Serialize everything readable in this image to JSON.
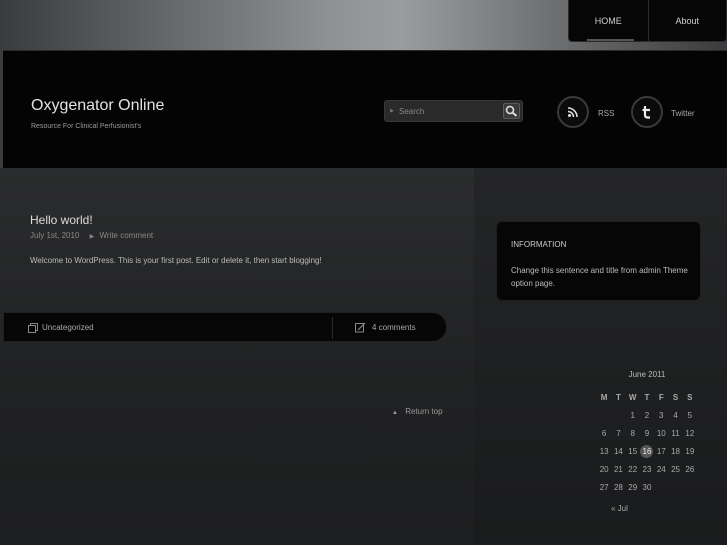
{
  "nav": {
    "home": "HOME",
    "about": "About"
  },
  "site": {
    "title": "Oxygenator Online",
    "tagline": "Resource For Clinical Perfusionist's"
  },
  "search": {
    "placeholder": "Search"
  },
  "social": {
    "rss": "RSS",
    "twitter": "Twitter"
  },
  "post": {
    "title": "Hello world!",
    "date": "July 1st, 2010",
    "write_comment": "Write comment",
    "body": "Welcome to WordPress. This is your first post. Edit or delete it, then start blogging!",
    "category": "Uncategorized",
    "comments": "4 comments"
  },
  "return_top": "Return top",
  "info": {
    "title": "INFORMATION",
    "text": "Change this sentence and title from admin Theme option page."
  },
  "calendar": {
    "caption": "June 2011",
    "days": [
      "M",
      "T",
      "W",
      "T",
      "F",
      "S",
      "S"
    ],
    "weeks": [
      [
        "",
        "",
        "1",
        "2",
        "3",
        "4",
        "5"
      ],
      [
        "6",
        "7",
        "8",
        "9",
        "10",
        "11",
        "12"
      ],
      [
        "13",
        "14",
        "15",
        "16",
        "17",
        "18",
        "19"
      ],
      [
        "20",
        "21",
        "22",
        "23",
        "24",
        "25",
        "26"
      ],
      [
        "27",
        "28",
        "29",
        "30",
        "",
        "",
        ""
      ]
    ],
    "today": "16",
    "prev": "« Jul"
  },
  "colors": {
    "header_bg": "#040404",
    "footer_bar": "#060606",
    "today_highlight": "#555555"
  },
  "icons": [
    "search-icon",
    "rss-icon",
    "twitter-icon",
    "category-icon",
    "comment-icon",
    "arrow-right-icon",
    "arrow-up-icon"
  ]
}
